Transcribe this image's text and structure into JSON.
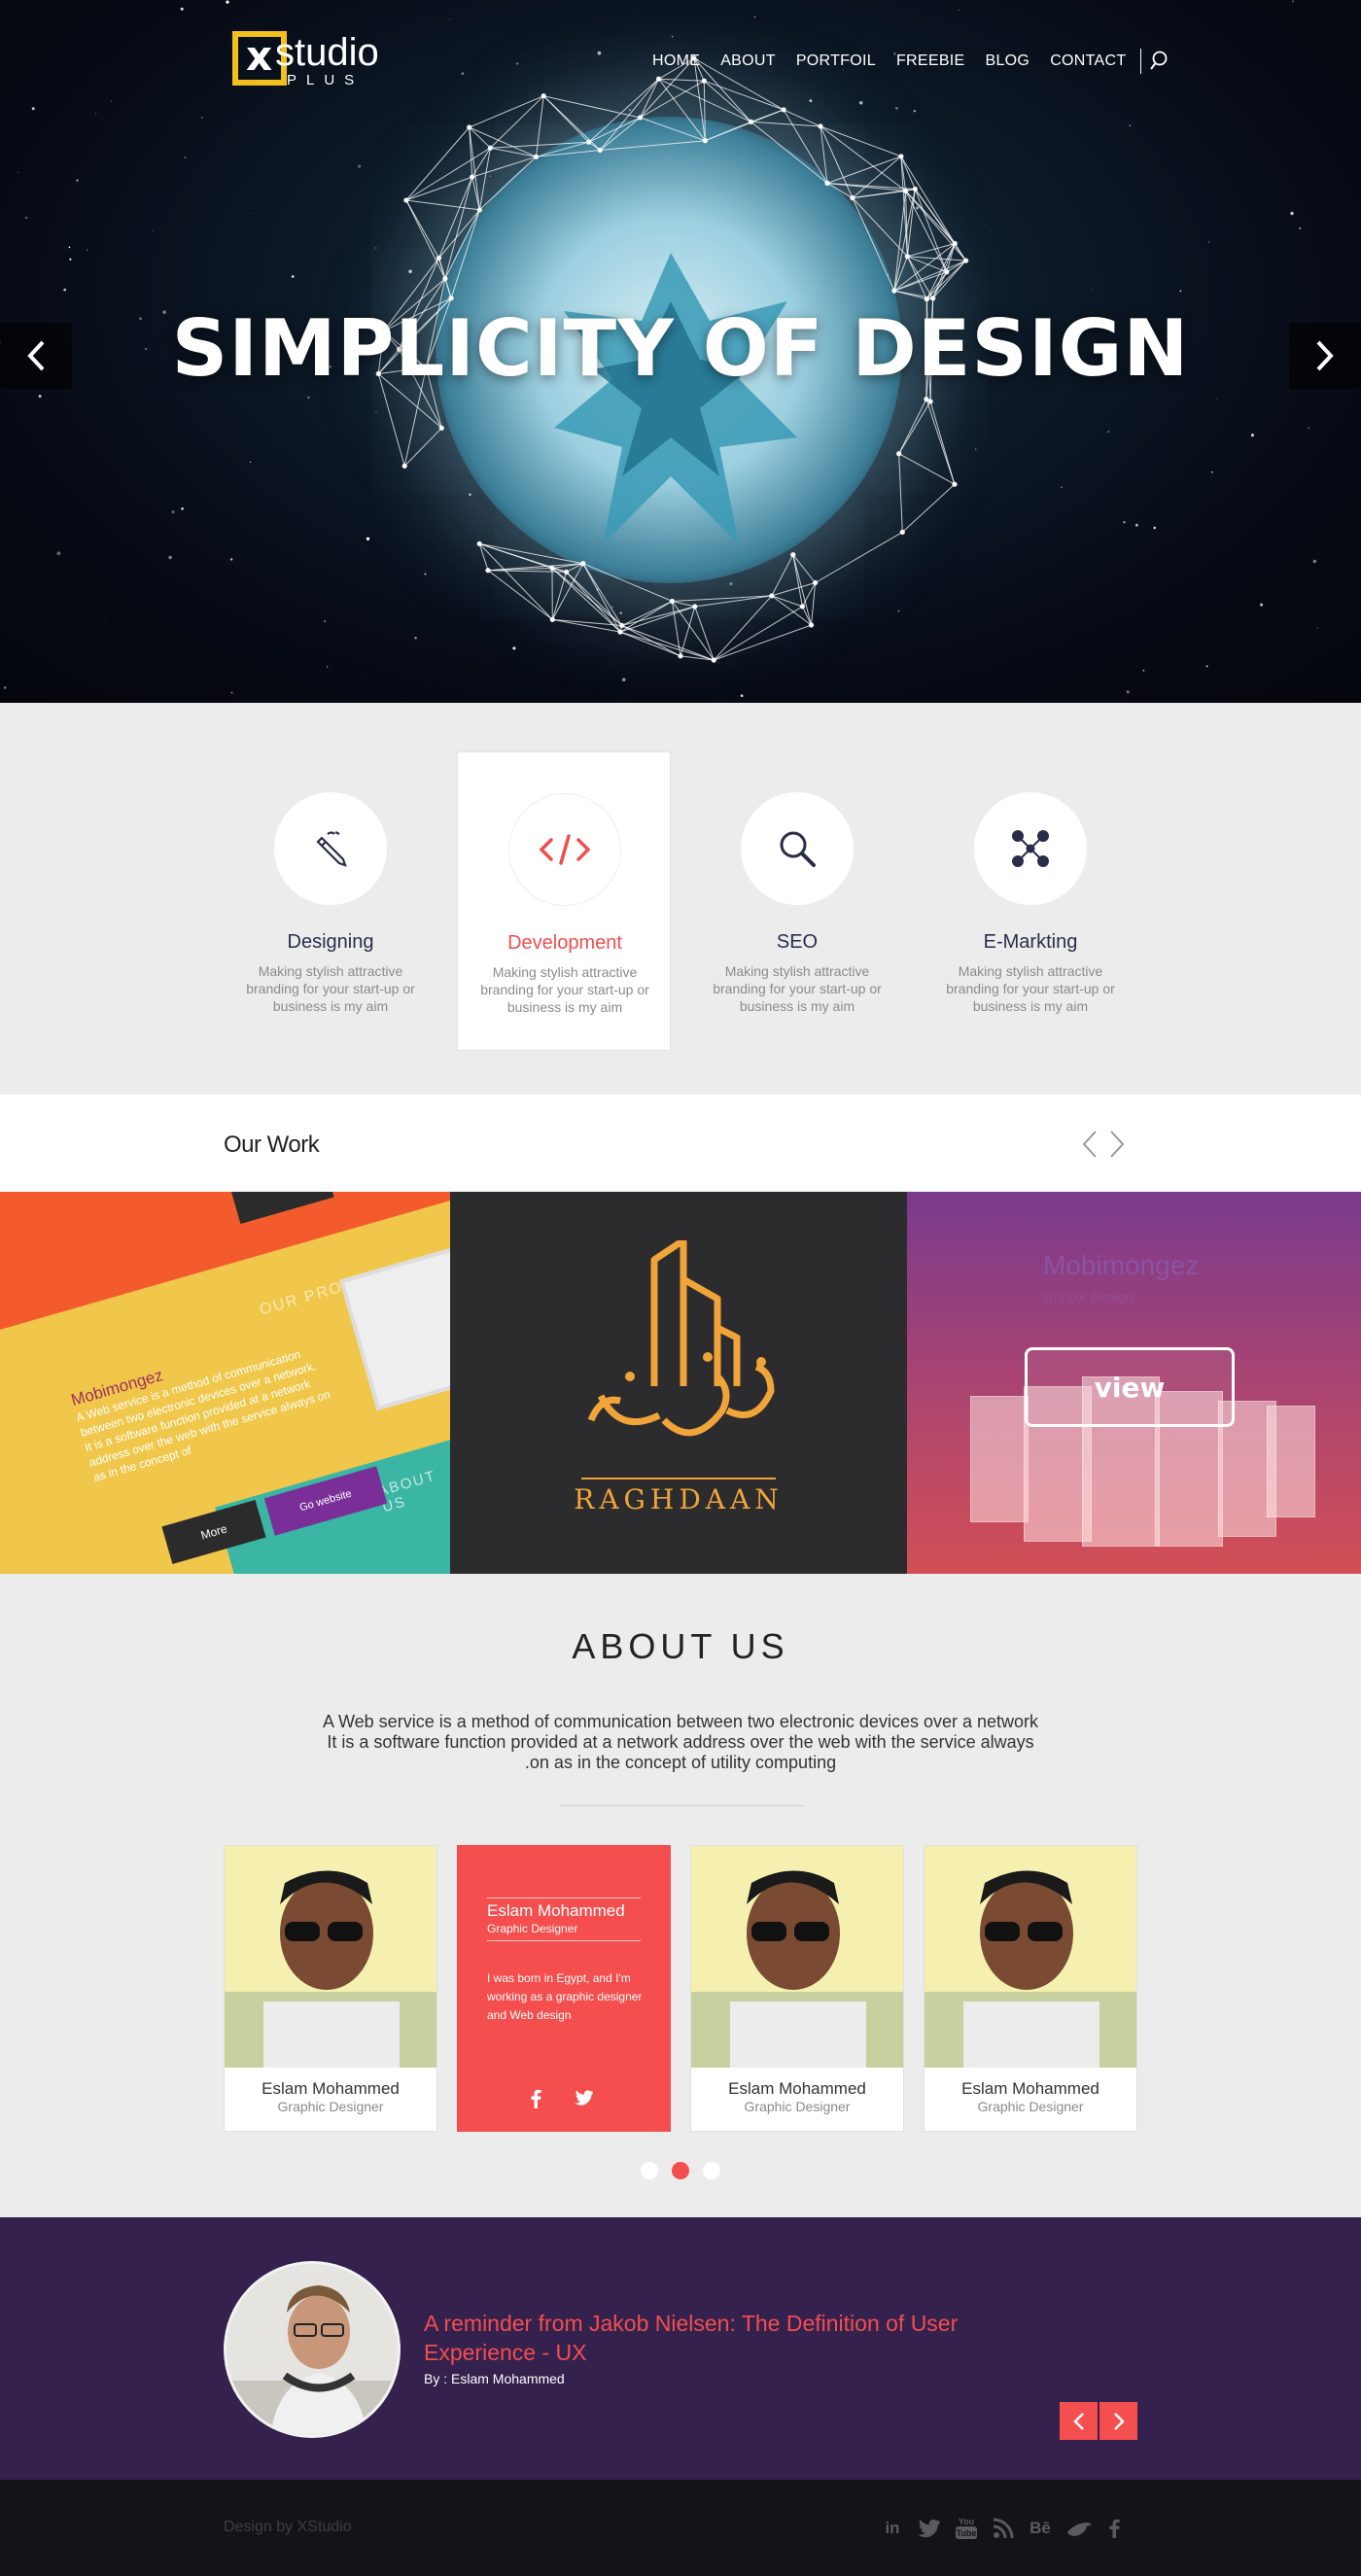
{
  "brand": {
    "logo_mark": "x",
    "logo_word": "studio",
    "logo_sub": "PLUS",
    "accent": "#f2c01d"
  },
  "nav": {
    "items": [
      "HOME",
      "ABOUT",
      "PORTFOIL",
      "FREEBIE",
      "BLOG",
      "CONTACT"
    ],
    "search_icon": "search-icon"
  },
  "hero": {
    "title": "SIMPLICITY OF DESIGN",
    "prev_icon": "chevron-left-icon",
    "next_icon": "chevron-right-icon"
  },
  "services": [
    {
      "title": "Designing",
      "text": "Making stylish attractive branding for your start-up or business is my aim",
      "icon": "pen-icon",
      "active": false
    },
    {
      "title": "Development",
      "text": "Making stylish attractive branding for your start-up or business is my aim",
      "icon": "code-icon",
      "active": true
    },
    {
      "title": "SEO",
      "text": "Making stylish attractive branding for your start-up or business is my aim",
      "icon": "search-icon",
      "active": false
    },
    {
      "title": "E-Markting",
      "text": "Making stylish attractive branding for your start-up or business is my aim",
      "icon": "social-network-icon",
      "active": false
    }
  ],
  "work": {
    "title": "Our Work",
    "project1": {
      "heading": "Mobimongez",
      "body": "A Web service is a method of communication between two electronic devices over a network. It is a software function provided at a network address over the web with the service always on as in the concept of",
      "our_project": "OUR PROJECT",
      "about_us": "ABOUT US",
      "more": "More",
      "go_website": "Go website"
    },
    "project2": {
      "wordmark": "RAGHDAAN"
    },
    "project3": {
      "title": "Mobimongez",
      "subtitle": "UI / UX Design",
      "view": "view"
    }
  },
  "about": {
    "title": "ABOUT US",
    "lines": [
      "A Web service is a method of communication between two electronic devices over a network",
      "It is a software function provided at a network address over the web with the service always",
      ".on as in the concept of utility computing"
    ],
    "team": [
      {
        "name": "Eslam Mohammed",
        "role": "Graphic Designer"
      },
      {
        "name": "Eslam Mohammed",
        "role": "Graphic Designer",
        "bio": "I was born in Egypt, and I'm working as a graphic designer and Web design"
      },
      {
        "name": "Eslam Mohammed",
        "role": "Graphic Designer"
      },
      {
        "name": "Eslam Mohammed",
        "role": "Graphic Designer"
      }
    ],
    "pager_active": 2
  },
  "testimonial": {
    "title": " A reminder from Jakob Nielsen: The Definition of User Experience - UX",
    "by": "By : Eslam Mohammed"
  },
  "footer": {
    "credit": "Design by XStudio",
    "social": [
      "linkedin-icon",
      "twitter-icon",
      "youtube-icon",
      "rss-icon",
      "behance-icon",
      "bird-icon",
      "facebook-icon"
    ]
  },
  "colors": {
    "red": "#f44e4e",
    "purple": "#34214d",
    "dark": "#141418"
  }
}
